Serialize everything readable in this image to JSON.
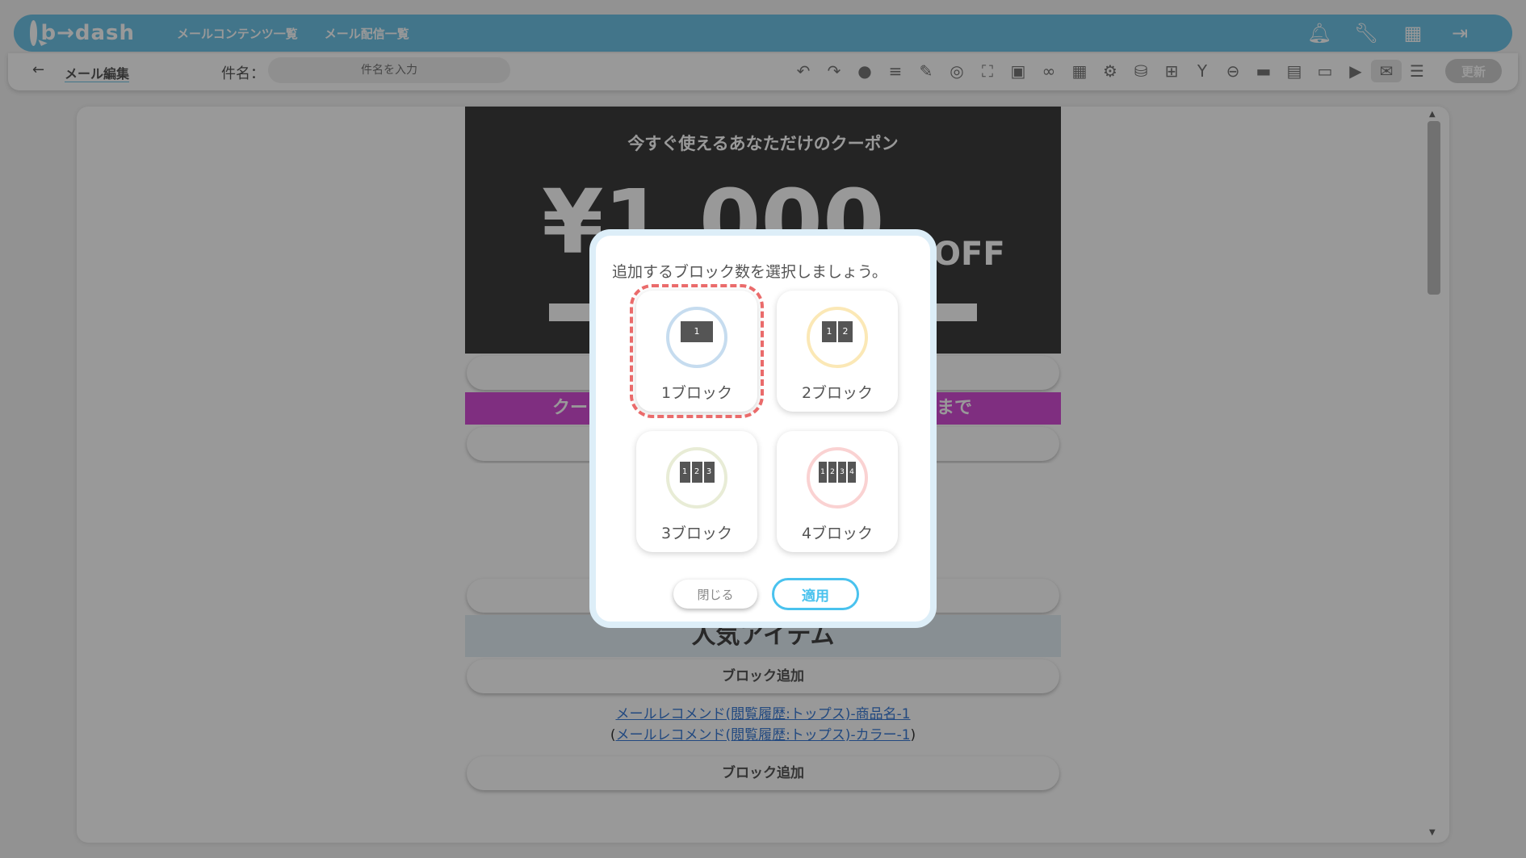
{
  "header": {
    "logo_text": "b→dash",
    "nav": [
      "メールコンテンツ一覧",
      "メール配信一覧"
    ]
  },
  "toolbar": {
    "page_label": "メール編集",
    "subject_label": "件名：",
    "subject_placeholder": "件名を入力",
    "update_label": "更新"
  },
  "mail": {
    "coupon_title": "今すぐ使えるあなただけのクーポン",
    "coupon_amount": "¥1,000",
    "coupon_off": "OFF",
    "band_left": "クー",
    "band_right": "まで",
    "section_title": "人気アイテム",
    "add_block_label": "ブロック追加",
    "rec_link_1": "メールレコメンド(閲覧履歴:トップス)-商品名-1",
    "rec_link_2_prefix": "(",
    "rec_link_2": "メールレコメンド(閲覧履歴:トップス)-カラー-1",
    "rec_link_2_suffix": ")"
  },
  "modal": {
    "title": "追加するブロック数を選択しましょう。",
    "options": [
      {
        "label": "1ブロック",
        "boxes": [
          "1"
        ],
        "ring_color": "#c6dcef"
      },
      {
        "label": "2ブロック",
        "boxes": [
          "1",
          "2"
        ],
        "ring_color": "#fbe8b6"
      },
      {
        "label": "3ブロック",
        "boxes": [
          "1",
          "2",
          "3"
        ],
        "ring_color": "#e8ecd6"
      },
      {
        "label": "4ブロック",
        "boxes": [
          "1",
          "2",
          "3",
          "4"
        ],
        "ring_color": "#fad2d2"
      }
    ],
    "selected_index": 0,
    "close_label": "閉じる",
    "apply_label": "適用"
  },
  "colors": {
    "header_bg": "#6ec3e6",
    "band": "#d44dd6",
    "selected_outline": "#ea6b6b",
    "apply": "#49c2ee"
  }
}
